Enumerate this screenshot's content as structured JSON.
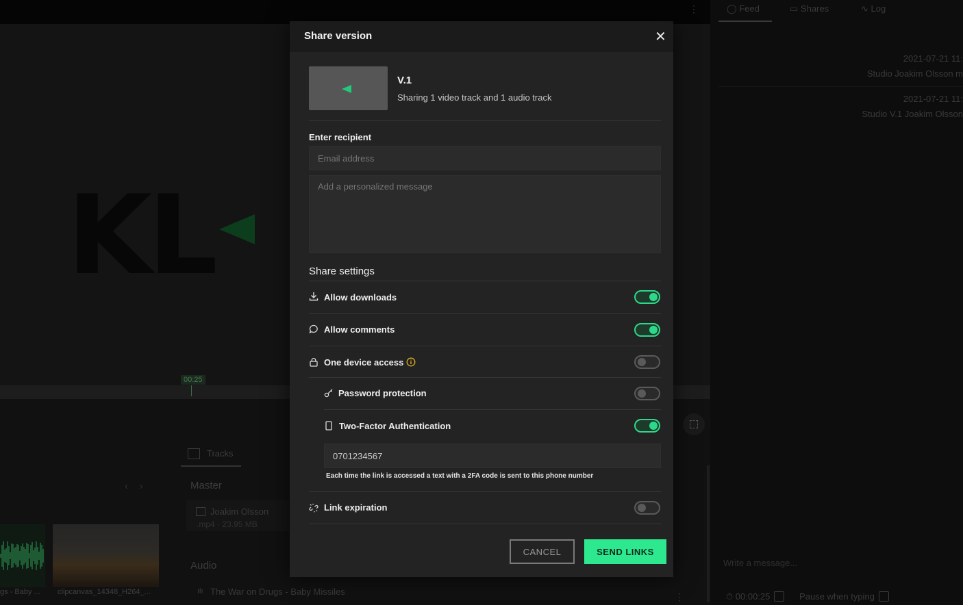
{
  "background": {
    "player": {
      "timecode": "00:25",
      "logo_text": "KL"
    },
    "tracks_tab": {
      "label": "Tracks"
    },
    "master_label": "Master",
    "master_clip": {
      "name": "Joakim Olsson",
      "meta": ".mp4 · 23.95 MB"
    },
    "audio_label": "Audio",
    "audio_clip": {
      "name": "The War on Drugs - Baby Missiles"
    },
    "thumbnails": [
      {
        "caption": "gs - Baby ..."
      },
      {
        "caption": "clipcanvas_14348_H264_..."
      }
    ],
    "right_panel": {
      "tabs": [
        {
          "label": "Feed"
        },
        {
          "label": "Shares"
        },
        {
          "label": "Log"
        }
      ],
      "feed": [
        {
          "time": "2021-07-21 11:",
          "text": "Studio Joakim Olsson m"
        },
        {
          "time": "2021-07-21 11:",
          "text": "Studio V.1 Joakim Olsson"
        }
      ],
      "write_placeholder": "Write a message...",
      "footer_time": "00:00:25",
      "footer_pause": "Pause when typing"
    }
  },
  "modal": {
    "title": "Share version",
    "version": {
      "label": "V.1",
      "subtitle": "Sharing 1 video track and 1 audio track"
    },
    "recipient_label": "Enter recipient",
    "email_placeholder": "Email address",
    "message_placeholder": "Add a personalized message",
    "share_settings_title": "Share settings",
    "settings": {
      "allow_downloads": {
        "label": "Allow downloads",
        "on": true
      },
      "allow_comments": {
        "label": "Allow comments",
        "on": true
      },
      "one_device_access": {
        "label": "One device access",
        "on": false
      },
      "password_protection": {
        "label": "Password protection",
        "on": false
      },
      "two_factor": {
        "label": "Two-Factor Authentication",
        "on": true
      },
      "link_expiration": {
        "label": "Link expiration",
        "on": false
      }
    },
    "phone_value": "0701234567",
    "phone_hint": "Each time the link is accessed a text with a 2FA code is sent to this phone number",
    "cancel_label": "CANCEL",
    "send_label": "SEND LINKS",
    "colors": {
      "accent": "#2ee88f",
      "toggle_on": "#2ed88a",
      "warning_icon": "#e0b020"
    }
  }
}
